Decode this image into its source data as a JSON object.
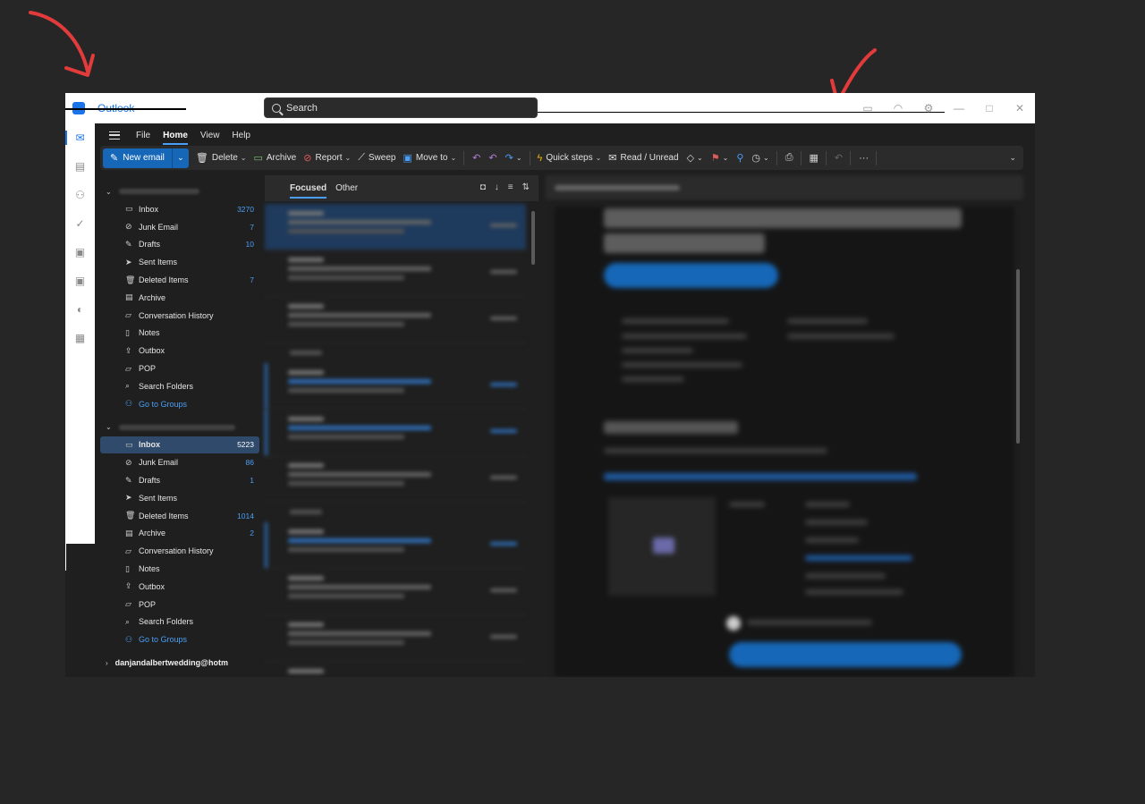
{
  "titlebar": {
    "app_name": "Outlook",
    "search_placeholder": "Search"
  },
  "menu": {
    "items": [
      "File",
      "Home",
      "View",
      "Help"
    ],
    "active": "Home"
  },
  "ribbon": {
    "new_email": "New email",
    "delete": "Delete",
    "archive": "Archive",
    "report": "Report",
    "sweep": "Sweep",
    "move_to": "Move to",
    "quick_steps": "Quick steps",
    "read_unread": "Read / Unread"
  },
  "account1": {
    "folders": [
      {
        "label": "Inbox",
        "count": "3270",
        "icon": "inbox-icon"
      },
      {
        "label": "Junk Email",
        "count": "7",
        "icon": "junk-icon"
      },
      {
        "label": "Drafts",
        "count": "10",
        "icon": "draft-icon"
      },
      {
        "label": "Sent Items",
        "count": "",
        "icon": "sent-icon"
      },
      {
        "label": "Deleted Items",
        "count": "7",
        "icon": "trash-icon"
      },
      {
        "label": "Archive",
        "count": "",
        "icon": "archive-icon"
      },
      {
        "label": "Conversation History",
        "count": "",
        "icon": "folder-icon"
      },
      {
        "label": "Notes",
        "count": "",
        "icon": "notes-icon"
      },
      {
        "label": "Outbox",
        "count": "",
        "icon": "outbox-icon"
      },
      {
        "label": "POP",
        "count": "",
        "icon": "folder-icon"
      },
      {
        "label": "Search Folders",
        "count": "",
        "icon": "search-folder-icon"
      }
    ],
    "groups_link": "Go to Groups"
  },
  "account2": {
    "folders": [
      {
        "label": "Inbox",
        "count": "5223",
        "icon": "inbox-icon",
        "selected": true
      },
      {
        "label": "Junk Email",
        "count": "86",
        "icon": "junk-icon"
      },
      {
        "label": "Drafts",
        "count": "1",
        "icon": "draft-icon"
      },
      {
        "label": "Sent Items",
        "count": "",
        "icon": "sent-icon"
      },
      {
        "label": "Deleted Items",
        "count": "1014",
        "icon": "trash-icon"
      },
      {
        "label": "Archive",
        "count": "2",
        "icon": "archive-icon"
      },
      {
        "label": "Conversation History",
        "count": "",
        "icon": "folder-icon"
      },
      {
        "label": "Notes",
        "count": "",
        "icon": "notes-icon"
      },
      {
        "label": "Outbox",
        "count": "",
        "icon": "outbox-icon"
      },
      {
        "label": "POP",
        "count": "",
        "icon": "folder-icon"
      },
      {
        "label": "Search Folders",
        "count": "",
        "icon": "search-folder-icon"
      }
    ],
    "groups_link": "Go to Groups"
  },
  "account3": {
    "name": "danjandalbertwedding@hotm"
  },
  "message_list": {
    "tabs": [
      "Focused",
      "Other"
    ],
    "active_tab": "Focused"
  },
  "colors": {
    "accent": "#4a9ef5",
    "button_blue": "#1667b7",
    "background": "#1f1f1f",
    "annotation_red": "#e23b3b"
  }
}
